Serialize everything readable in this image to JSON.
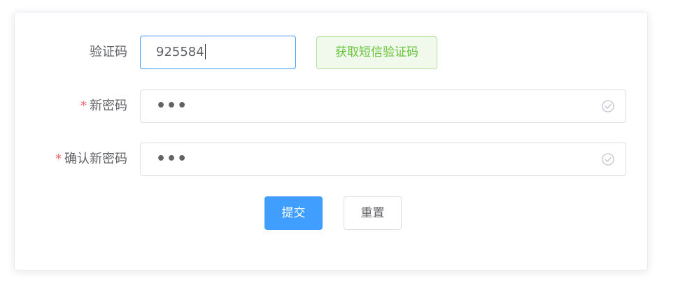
{
  "form": {
    "code": {
      "label": "验证码",
      "value": "925584",
      "focused": true
    },
    "sms_button_label": "获取短信验证码",
    "new_password": {
      "label": "新密码",
      "required_mark": "*",
      "value_masked": "•••",
      "status_icon": "check-circle-icon"
    },
    "confirm_password": {
      "label": "确认新密码",
      "required_mark": "*",
      "value_masked": "•••",
      "status_icon": "check-circle-icon"
    },
    "submit_label": "提交",
    "reset_label": "重置"
  },
  "colors": {
    "primary": "#409eff",
    "success": "#67c23a",
    "success_bg": "#f0f9eb",
    "danger": "#f56c6c",
    "text": "#606266",
    "border": "#dcdfe6"
  }
}
